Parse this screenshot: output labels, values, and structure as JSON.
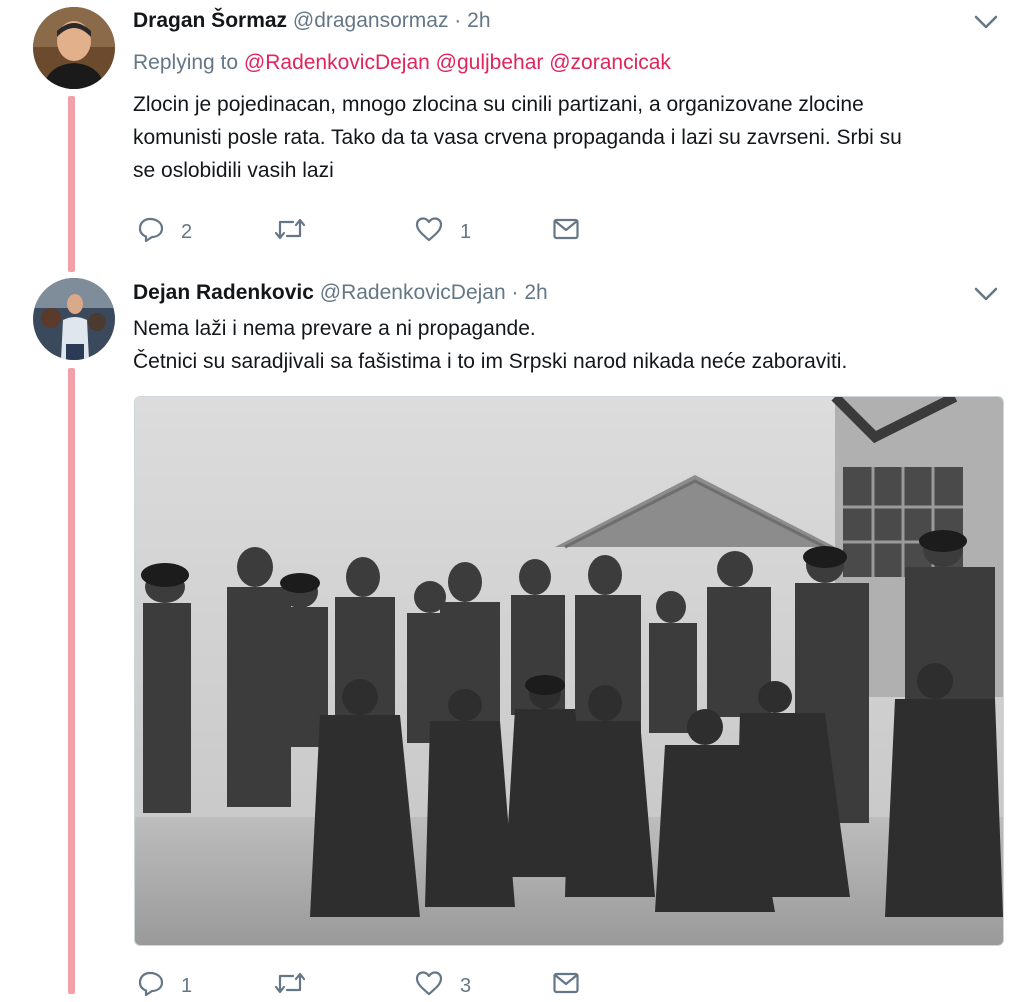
{
  "tweets": [
    {
      "name": "Dragan Šormaz",
      "handle": "@dragansormaz",
      "dot": "·",
      "time": "2h",
      "replying_label": "Replying to",
      "mentions": [
        "@RadenkovicDejan",
        "@guljbehar",
        "@zorancicak"
      ],
      "text_lines": [
        "Zlocin je pojedinacan, mnogo zlocina su cinili partizani, a organizovane zlocine",
        "komunisti posle rata. Tako da ta vasa crvena propaganda i lazi su zavrseni. Srbi su",
        "se oslobidili vasih lazi"
      ],
      "replies": "2",
      "retweets": "",
      "likes": "1"
    },
    {
      "name": "Dejan Radenkovic",
      "handle": "@RadenkovicDejan",
      "dot": "·",
      "time": "2h",
      "text_lines": [
        "Nema laži i nema prevare a ni propagande.",
        "Četnici su saradjivali sa fašistima i to im Srpski narod nikada neće zaboraviti."
      ],
      "replies": "1",
      "retweets": "",
      "likes": "3"
    }
  ],
  "icons": {
    "reply": "reply-icon",
    "retweet": "retweet-icon",
    "like": "heart-icon",
    "message": "envelope-icon",
    "caret": "chevron-down-icon"
  },
  "colors": {
    "thread_line": "#f4a0a8",
    "mention": "#e0245e",
    "secondary_text": "#657786",
    "icon": "#657786"
  }
}
